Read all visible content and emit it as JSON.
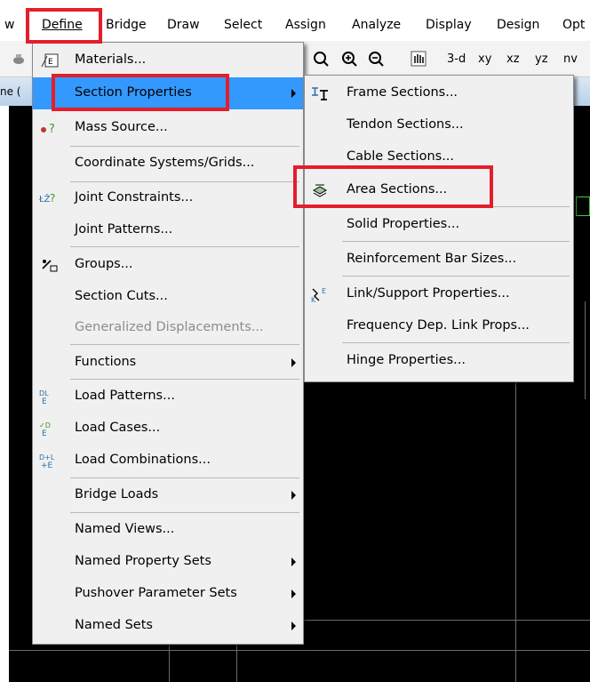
{
  "menubar": {
    "prev_partial": "w",
    "items": [
      "Define",
      "Bridge",
      "Draw",
      "Select",
      "Assign",
      "Analyze",
      "Display",
      "Design",
      "Opt"
    ]
  },
  "toolbar": {
    "views": [
      "3-d",
      "xy",
      "xz",
      "yz",
      "nv"
    ]
  },
  "window": {
    "title_partial": "ne ("
  },
  "define_menu": {
    "items": [
      {
        "label": "Materials...",
        "icon": "materials-icon"
      },
      {
        "label": "Section Properties",
        "icon": null,
        "submenu": true,
        "highlighted": true
      },
      {
        "label": "Mass  Source...",
        "icon": "mass-source-icon"
      },
      {
        "label": "Coordinate Systems/Grids...",
        "icon": null
      },
      {
        "label": "Joint Constraints...",
        "icon": "joint-constraints-icon"
      },
      {
        "label": "Joint Patterns...",
        "icon": null
      },
      {
        "label": "Groups...",
        "icon": "groups-icon"
      },
      {
        "label": "Section Cuts...",
        "icon": null
      },
      {
        "label": "Generalized Displacements...",
        "icon": null,
        "disabled": true
      },
      {
        "label": "Functions",
        "icon": null,
        "submenu": true
      },
      {
        "label": "Load Patterns...",
        "icon": "load-patterns-icon"
      },
      {
        "label": "Load Cases...",
        "icon": "load-cases-icon"
      },
      {
        "label": "Load Combinations...",
        "icon": "load-combinations-icon"
      },
      {
        "label": "Bridge Loads",
        "icon": null,
        "submenu": true
      },
      {
        "label": "Named Views...",
        "icon": null
      },
      {
        "label": "Named Property Sets",
        "icon": null,
        "submenu": true
      },
      {
        "label": "Pushover Parameter Sets",
        "icon": null,
        "submenu": true
      },
      {
        "label": "Named Sets",
        "icon": null,
        "submenu": true
      }
    ]
  },
  "section_menu": {
    "items": [
      {
        "label": "Frame Sections...",
        "icon": "frame-sections-icon"
      },
      {
        "label": "Tendon Sections...",
        "icon": null
      },
      {
        "label": "Cable Sections...",
        "icon": null
      },
      {
        "label": "Area Sections...",
        "icon": "area-sections-icon"
      },
      {
        "label": "Solid Properties...",
        "icon": null
      },
      {
        "label": "Reinforcement Bar Sizes...",
        "icon": null
      },
      {
        "label": "Link/Support Properties...",
        "icon": "link-support-icon"
      },
      {
        "label": "Frequency Dep. Link Props...",
        "icon": null
      },
      {
        "label": "Hinge Properties...",
        "icon": null
      }
    ]
  },
  "colors": {
    "highlight": "#3399ff",
    "callout": "#e41e2b",
    "canvas": "#000000"
  }
}
